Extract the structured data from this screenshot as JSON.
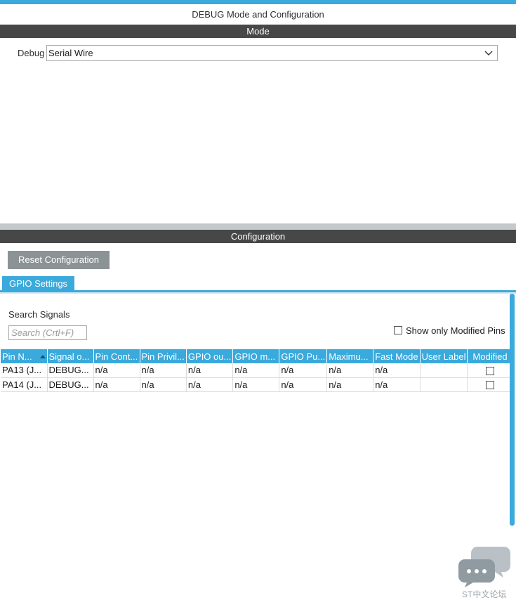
{
  "window": {
    "title": "DEBUG Mode and Configuration"
  },
  "mode": {
    "section_title": "Mode",
    "debug_label": "Debug",
    "debug_value": "Serial Wire"
  },
  "configuration": {
    "section_title": "Configuration",
    "reset_button": "Reset Configuration",
    "tabs": [
      {
        "label": "GPIO Settings",
        "active": true
      }
    ],
    "search": {
      "label": "Search Signals",
      "placeholder": "Search (Crtl+F)",
      "value": ""
    },
    "show_modified": {
      "label": "Show only Modified Pins",
      "checked": false
    },
    "table": {
      "columns": [
        "Pin N...",
        "Signal o...",
        "Pin Cont...",
        "Pin Privil...",
        "GPIO ou...",
        "GPIO m...",
        "GPIO Pu...",
        "Maximu...",
        "Fast Mode",
        "User Label",
        "Modified"
      ],
      "rows": [
        {
          "cells": [
            "PA13 (J...",
            "DEBUG...",
            "n/a",
            "n/a",
            "n/a",
            "n/a",
            "n/a",
            "n/a",
            "n/a",
            ""
          ],
          "modified": false
        },
        {
          "cells": [
            "PA14 (J...",
            "DEBUG...",
            "n/a",
            "n/a",
            "n/a",
            "n/a",
            "n/a",
            "n/a",
            "n/a",
            ""
          ],
          "modified": false
        }
      ]
    }
  },
  "watermark": {
    "text": "ST中文论坛"
  },
  "colors": {
    "accent": "#3aa9dc",
    "section_bar": "#474747",
    "button_gray": "#8c9396"
  }
}
